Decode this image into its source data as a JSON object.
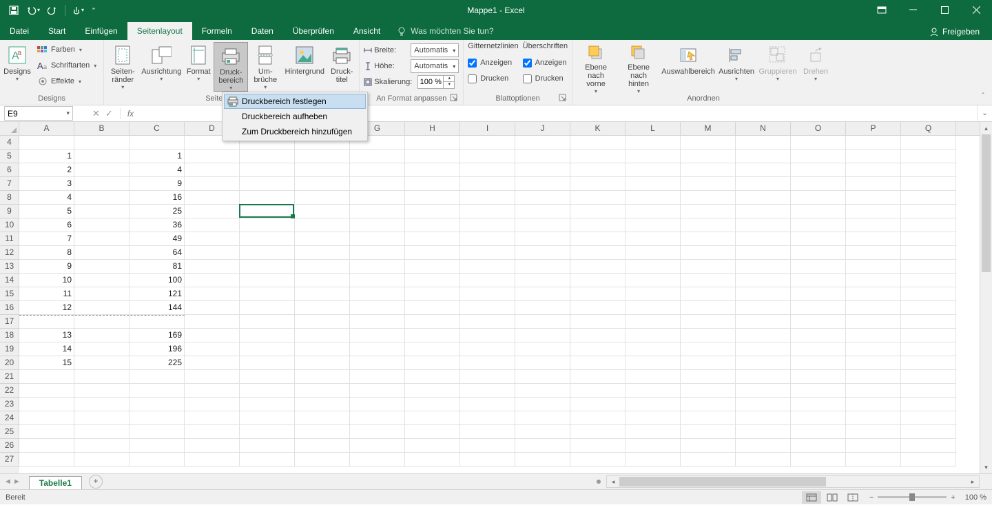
{
  "app_title": "Mappe1 - Excel",
  "qat": {
    "save": "save",
    "undo": "undo",
    "redo": "redo",
    "touch": "touch"
  },
  "tabs": {
    "datei": "Datei",
    "start": "Start",
    "einfuegen": "Einfügen",
    "seitenlayout": "Seitenlayout",
    "formeln": "Formeln",
    "daten": "Daten",
    "ueberpruefen": "Überprüfen",
    "ansicht": "Ansicht",
    "tellme": "Was möchten Sie tun?",
    "share": "Freigeben"
  },
  "ribbon": {
    "designs": {
      "label": "Designs",
      "btn": "Designs",
      "farben": "Farben",
      "schriftarten": "Schriftarten",
      "effekte": "Effekte"
    },
    "seite": {
      "label": "Seite einrichten",
      "raender": "Seiten-\nränder",
      "ausrichtung": "Ausrichtung",
      "format": "Format",
      "druckbereich": "Druck-\nbereich",
      "umbrueche": "Um-\nbrüche",
      "hintergrund": "Hintergrund",
      "drucktitel": "Druck-\ntitel"
    },
    "anpassen": {
      "label": "An Format anpassen",
      "breite": "Breite:",
      "breite_val": "Automatis",
      "hoehe": "Höhe:",
      "hoehe_val": "Automatis",
      "skalierung": "Skalierung:",
      "skalierung_val": "100 %"
    },
    "blattopt": {
      "label": "Blattoptionen",
      "gitter": "Gitternetzlinien",
      "ueberschriften": "Überschriften",
      "anzeigen": "Anzeigen",
      "drucken": "Drucken"
    },
    "anordnen": {
      "label": "Anordnen",
      "vorne": "Ebene nach\nvorne",
      "hinten": "Ebene nach\nhinten",
      "auswahl": "Auswahlbereich",
      "ausrichten": "Ausrichten",
      "gruppieren": "Gruppieren",
      "drehen": "Drehen"
    }
  },
  "dropdown": {
    "festlegen": "Druckbereich festlegen",
    "aufheben": "Druckbereich aufheben",
    "hinzufuegen": "Zum Druckbereich hinzufügen"
  },
  "namebox": "E9",
  "columns": [
    "A",
    "B",
    "C",
    "D",
    "E",
    "F",
    "G",
    "H",
    "I",
    "J",
    "K",
    "L",
    "M",
    "N",
    "O",
    "P",
    "Q"
  ],
  "row_start": 4,
  "row_count": 24,
  "data_rows": [
    {
      "r": 5,
      "A": "1",
      "C": "1"
    },
    {
      "r": 6,
      "A": "2",
      "C": "4"
    },
    {
      "r": 7,
      "A": "3",
      "C": "9"
    },
    {
      "r": 8,
      "A": "4",
      "C": "16"
    },
    {
      "r": 9,
      "A": "5",
      "C": "25"
    },
    {
      "r": 10,
      "A": "6",
      "C": "36"
    },
    {
      "r": 11,
      "A": "7",
      "C": "49"
    },
    {
      "r": 12,
      "A": "8",
      "C": "64"
    },
    {
      "r": 13,
      "A": "9",
      "C": "81"
    },
    {
      "r": 14,
      "A": "10",
      "C": "100"
    },
    {
      "r": 15,
      "A": "11",
      "C": "121"
    },
    {
      "r": 16,
      "A": "12",
      "C": "144"
    },
    {
      "r": 18,
      "A": "13",
      "C": "169"
    },
    {
      "r": 19,
      "A": "14",
      "C": "196"
    },
    {
      "r": 20,
      "A": "15",
      "C": "225"
    }
  ],
  "selected_cell": {
    "col": "E",
    "row": 9
  },
  "sheet_tab": "Tabelle1",
  "status_text": "Bereit",
  "zoom": "100 %"
}
